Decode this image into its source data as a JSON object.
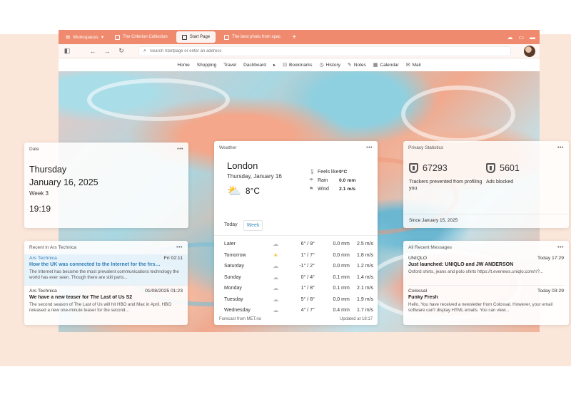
{
  "browser": {
    "workspace_label": "Workspaces",
    "tabs": [
      {
        "label": "The Criterion Collection",
        "active": false
      },
      {
        "label": "Start Page",
        "active": true
      },
      {
        "label": "The best photo from spac",
        "active": false
      }
    ],
    "address_placeholder": "Search Startpage or enter an address"
  },
  "navbar": {
    "links": [
      "Home",
      "Shopping",
      "Travel",
      "Dashboard"
    ],
    "play": "▸",
    "items": [
      {
        "label": "Bookmarks",
        "icon": "bookmark-icon"
      },
      {
        "label": "History",
        "icon": "history-icon"
      },
      {
        "label": "Notes",
        "icon": "notes-icon"
      },
      {
        "label": "Calendar",
        "icon": "calendar-icon"
      },
      {
        "label": "Mail",
        "icon": "mail-icon"
      }
    ]
  },
  "date_widget": {
    "title": "Date",
    "weekday": "Thursday",
    "date": "January 16, 2025",
    "week": "Week 3",
    "time": "19:19"
  },
  "weather_widget": {
    "title": "Weather",
    "city": "London",
    "date": "Thursday, January 16",
    "temp": "8°C",
    "stats": [
      {
        "label": "Feels like",
        "value": "9°C",
        "icon": "thermometer-icon"
      },
      {
        "label": "Rain",
        "value": "0.0 mm",
        "icon": "rain-icon"
      },
      {
        "label": "Wind",
        "value": "2.1 m/s",
        "icon": "wind-icon"
      }
    ],
    "tabs": [
      "Today",
      "Week"
    ],
    "selected_tab": "Week",
    "forecast": [
      {
        "day": "Later",
        "temp": "6° / 9°",
        "rain": "0.0 mm",
        "wind": "2.5 m/s",
        "icon": "cloud-icon"
      },
      {
        "day": "Tomorrow",
        "temp": "1° / 7°",
        "rain": "0.0 mm",
        "wind": "1.8 m/s",
        "icon": "sun-icon"
      },
      {
        "day": "Saturday",
        "temp": "-1° / 2°",
        "rain": "0.0 mm",
        "wind": "1.2 m/s",
        "icon": "cloud-icon"
      },
      {
        "day": "Sunday",
        "temp": "0° / 4°",
        "rain": "0.1 mm",
        "wind": "1.4 m/s",
        "icon": "cloud-icon"
      },
      {
        "day": "Monday",
        "temp": "1° / 8°",
        "rain": "0.1 mm",
        "wind": "2.1 m/s",
        "icon": "cloud-rain-icon"
      },
      {
        "day": "Tuesday",
        "temp": "5° / 8°",
        "rain": "0.0 mm",
        "wind": "1.9 m/s",
        "icon": "cloud-rain-icon"
      },
      {
        "day": "Wednesday",
        "temp": "4° / 7°",
        "rain": "0.4 mm",
        "wind": "1.7 m/s",
        "icon": "cloud-rain-icon"
      }
    ],
    "source": "Forecast from MET.no",
    "updated": "Updated at 18:17"
  },
  "privacy_widget": {
    "title": "Privacy Statistics",
    "trackers_count": "67293",
    "trackers_label": "Trackers prevented from profiling you",
    "ads_count": "5601",
    "ads_label": "Ads blocked",
    "since": "Since January 15, 2025"
  },
  "ars_widget": {
    "title": "Recent in Ars Technica",
    "items": [
      {
        "source": "Ars Technica",
        "time": "Fri 02:11",
        "title": "How the UK was connected to the Internet for the firs…",
        "body": "The Internet has become the most prevalent communications technology the world has ever seen. Though there are still parts...",
        "highlight": true
      },
      {
        "source": "Ars Technica",
        "time": "01/08/2025 01:23",
        "title": "We have a new teaser for The Last of Us S2",
        "body": "The second season of The Last of Us will hit HBO and Max in April. HBO released a new one-minute teaser for the second...",
        "highlight": false
      }
    ]
  },
  "messages_widget": {
    "title": "All Recent Messages",
    "items": [
      {
        "source": "UNIQLO",
        "time": "Today 17:29",
        "title": "Just launched: UNIQLO and JW ANDERSON",
        "body": "Oxford shirts, jeans and polo shirts https://t.evenews.uniqlo.com/r/?..."
      },
      {
        "source": "Colossal",
        "time": "Today 03:29",
        "title": "Funky Fresh",
        "body": "Hello, You have received a newsletter from Colossal. However, your email software can't display HTML emails. You can view..."
      }
    ]
  }
}
